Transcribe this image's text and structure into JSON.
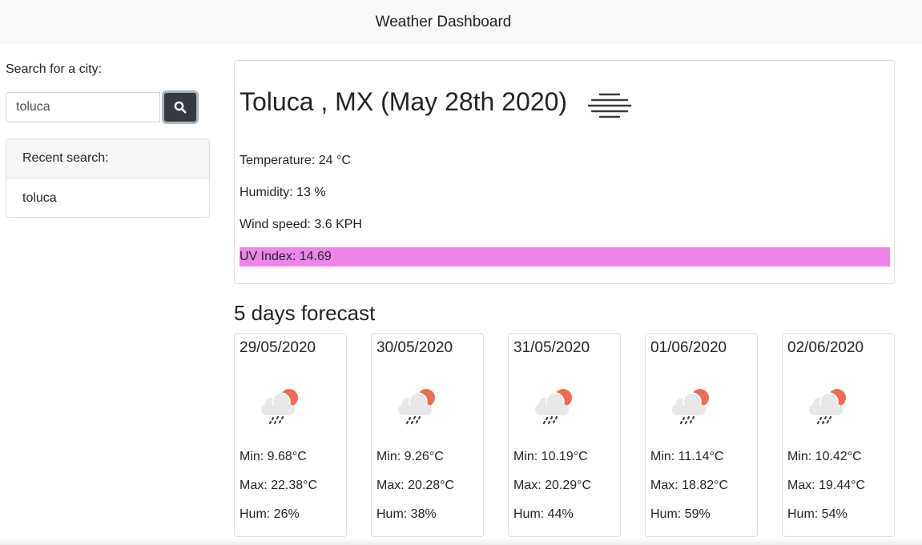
{
  "navbar": {
    "title": "Weather Dashboard"
  },
  "search": {
    "label": "Search for a city:",
    "value": "toluca",
    "button_icon": "search-icon"
  },
  "recent": {
    "header": "Recent search:",
    "items": [
      "toluca"
    ]
  },
  "current": {
    "title": "Toluca , MX (May 28th 2020)",
    "icon": "mist-icon",
    "temperature": "Temperature: 24 °C",
    "humidity": "Humidity: 13 %",
    "wind": "Wind speed: 3.6 KPH",
    "uv": "UV Index: 14.69",
    "uv_color": "#ef84ea"
  },
  "forecast": {
    "title": "5 days forecast",
    "days": [
      {
        "date": "29/05/2020",
        "icon": "rain-sun-icon",
        "min": "Min: 9.68°C",
        "max": "Max: 22.38°C",
        "hum": "Hum: 26%"
      },
      {
        "date": "30/05/2020",
        "icon": "rain-sun-icon",
        "min": "Min: 9.26°C",
        "max": "Max: 20.28°C",
        "hum": "Hum: 38%"
      },
      {
        "date": "31/05/2020",
        "icon": "rain-sun-icon",
        "min": "Min: 10.19°C",
        "max": "Max: 20.29°C",
        "hum": "Hum: 44%"
      },
      {
        "date": "01/06/2020",
        "icon": "rain-sun-icon",
        "min": "Min: 11.14°C",
        "max": "Max: 18.82°C",
        "hum": "Hum: 59%"
      },
      {
        "date": "02/06/2020",
        "icon": "rain-sun-icon",
        "min": "Min: 10.42°C",
        "max": "Max: 19.44°C",
        "hum": "Hum: 54%"
      }
    ]
  }
}
